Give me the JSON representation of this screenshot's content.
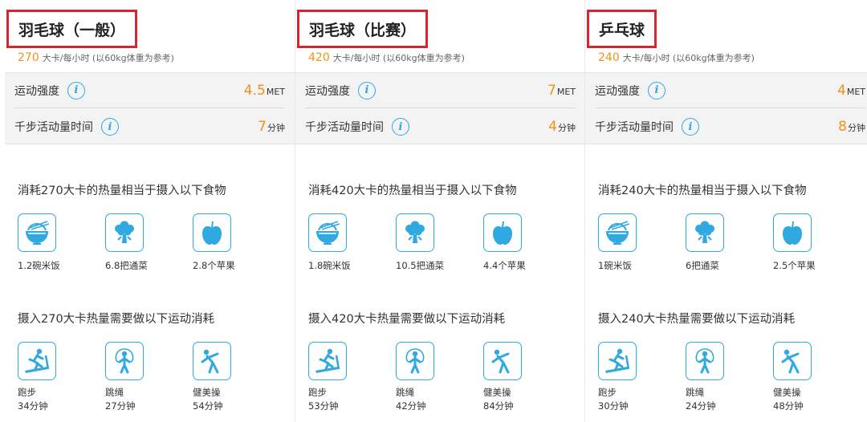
{
  "accent_color": "#f39216",
  "icon_color": "#2fa9df",
  "highlight_border": "#d9262c",
  "panels": [
    {
      "title": "羽毛球（一般）",
      "kcal": "270",
      "kcal_note": "大卡/每小时 (以60kg体重为参考)",
      "intensity_label": "运动强度",
      "intensity_value": "4.5",
      "intensity_unit": "MET",
      "steps_label": "千步活动量时间",
      "steps_value": "7",
      "steps_unit": "分钟",
      "food_title": "消耗270大卡的热量相当于摄入以下食物",
      "foods": [
        {
          "icon": "rice-bowl-icon",
          "label": "1.2碗米饭"
        },
        {
          "icon": "broccoli-icon",
          "label": "6.8把通菜"
        },
        {
          "icon": "apple-icon",
          "label": "2.8个苹果"
        }
      ],
      "exercise_title": "摄入270大卡热量需要做以下运动消耗",
      "exercises": [
        {
          "icon": "running-icon",
          "label": "跑步",
          "minutes": "34分钟"
        },
        {
          "icon": "jump-rope-icon",
          "label": "跳绳",
          "minutes": "27分钟"
        },
        {
          "icon": "aerobics-icon",
          "label": "健美操",
          "minutes": "54分钟"
        }
      ]
    },
    {
      "title": "羽毛球（比赛）",
      "kcal": "420",
      "kcal_note": "大卡/每小时 (以60kg体重为参考)",
      "intensity_label": "运动强度",
      "intensity_value": "7",
      "intensity_unit": "MET",
      "steps_label": "千步活动量时间",
      "steps_value": "4",
      "steps_unit": "分钟",
      "food_title": "消耗420大卡的热量相当于摄入以下食物",
      "foods": [
        {
          "icon": "rice-bowl-icon",
          "label": "1.8碗米饭"
        },
        {
          "icon": "broccoli-icon",
          "label": "10.5把通菜"
        },
        {
          "icon": "apple-icon",
          "label": "4.4个苹果"
        }
      ],
      "exercise_title": "摄入420大卡热量需要做以下运动消耗",
      "exercises": [
        {
          "icon": "running-icon",
          "label": "跑步",
          "minutes": "53分钟"
        },
        {
          "icon": "jump-rope-icon",
          "label": "跳绳",
          "minutes": "42分钟"
        },
        {
          "icon": "aerobics-icon",
          "label": "健美操",
          "minutes": "84分钟"
        }
      ]
    },
    {
      "title": "乒乓球",
      "kcal": "240",
      "kcal_note": "大卡/每小时 (以60kg体重为参考)",
      "intensity_label": "运动强度",
      "intensity_value": "4",
      "intensity_unit": "MET",
      "steps_label": "千步活动量时间",
      "steps_value": "8",
      "steps_unit": "分钟",
      "food_title": "消耗240大卡的热量相当于摄入以下食物",
      "foods": [
        {
          "icon": "rice-bowl-icon",
          "label": "1碗米饭"
        },
        {
          "icon": "broccoli-icon",
          "label": "6把通菜"
        },
        {
          "icon": "apple-icon",
          "label": "2.5个苹果"
        }
      ],
      "exercise_title": "摄入240大卡热量需要做以下运动消耗",
      "exercises": [
        {
          "icon": "running-icon",
          "label": "跑步",
          "minutes": "30分钟"
        },
        {
          "icon": "jump-rope-icon",
          "label": "跳绳",
          "minutes": "24分钟"
        },
        {
          "icon": "aerobics-icon",
          "label": "健美操",
          "minutes": "48分钟"
        }
      ]
    }
  ]
}
